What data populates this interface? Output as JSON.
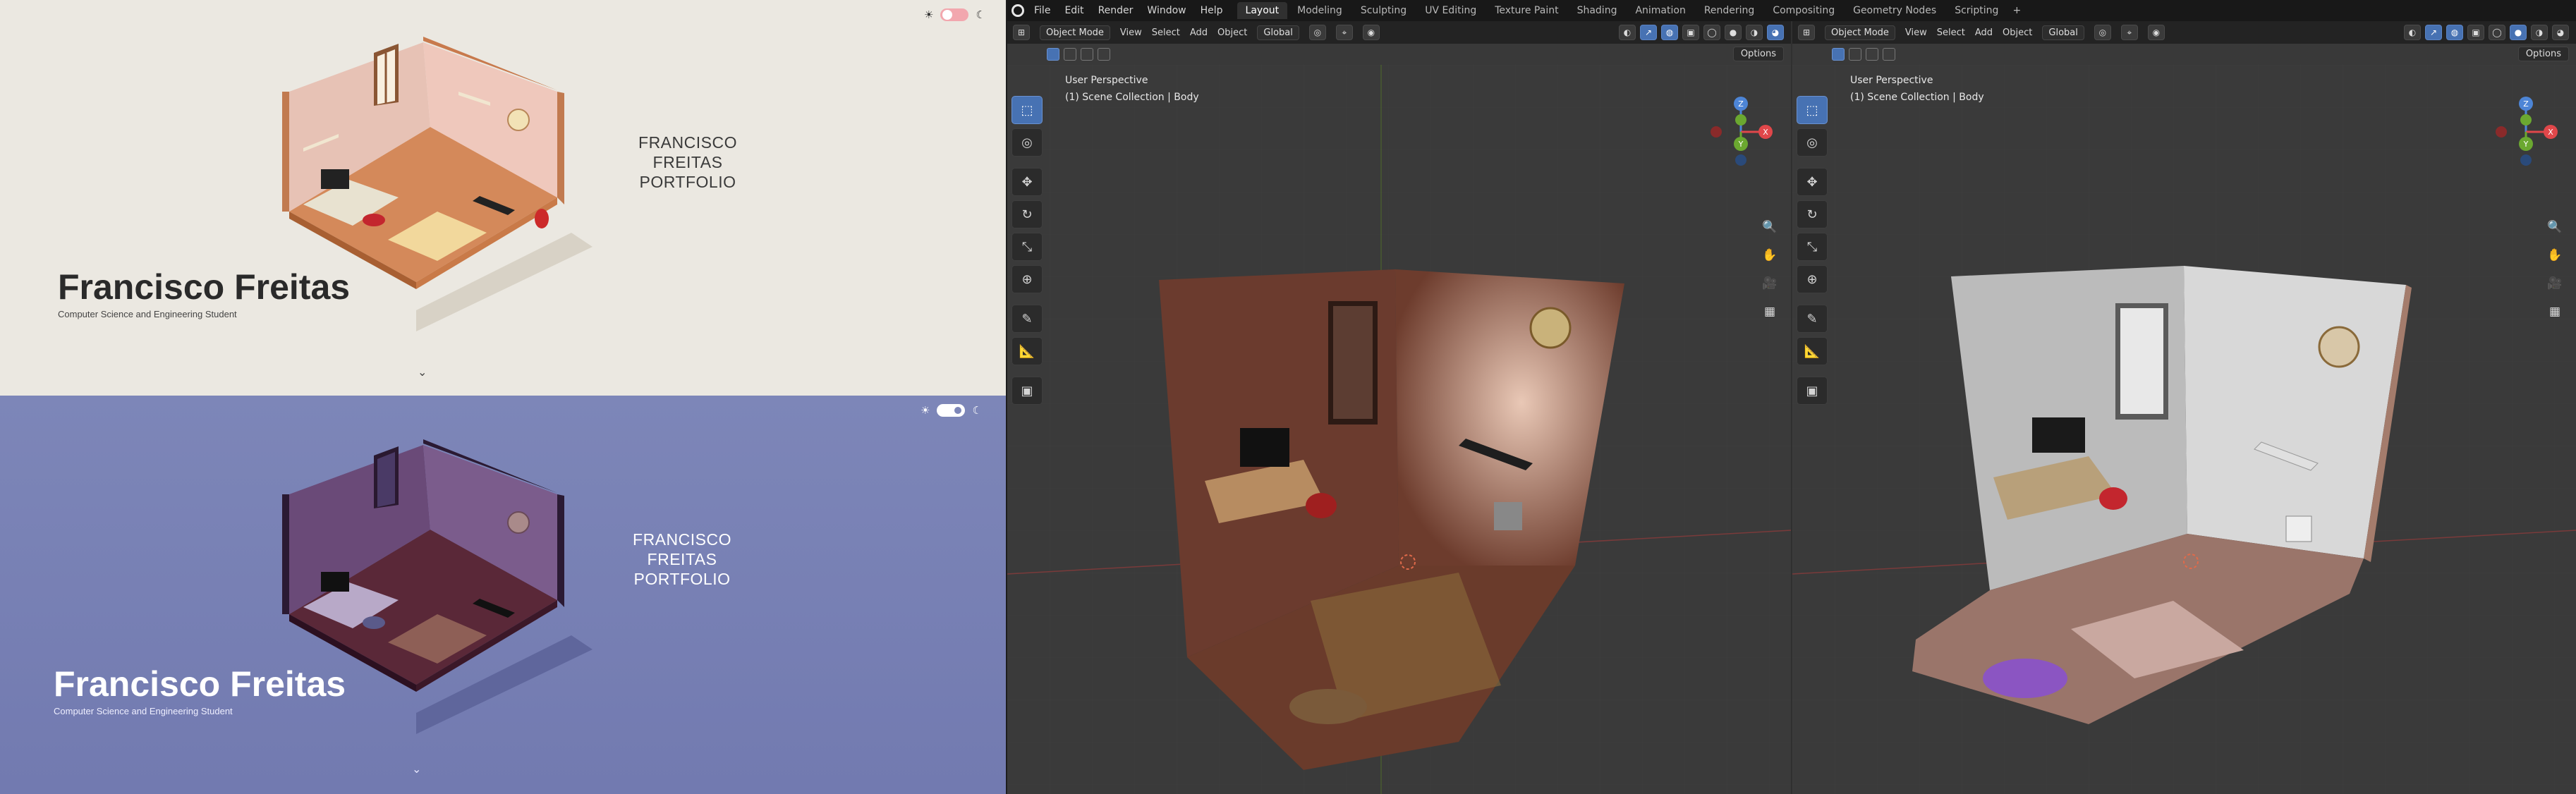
{
  "portfolio_light": {
    "name": "Francisco Freitas",
    "subtitle": "Computer Science and Engineering Student",
    "heading_line1": "FRANCISCO FREITAS",
    "heading_line2": "PORTFOLIO",
    "scroll_icon": "chevron-down-icon",
    "theme": "light"
  },
  "portfolio_dark": {
    "name": "Francisco Freitas",
    "subtitle": "Computer Science and Engineering Student",
    "heading_line1": "FRANCISCO FREITAS",
    "heading_line2": "PORTFOLIO",
    "scroll_icon": "chevron-down-icon",
    "theme": "dark"
  },
  "blender": {
    "menus": [
      "File",
      "Edit",
      "Render",
      "Window",
      "Help"
    ],
    "workspaces": [
      "Layout",
      "Modeling",
      "Sculpting",
      "UV Editing",
      "Texture Paint",
      "Shading",
      "Animation",
      "Rendering",
      "Compositing",
      "Geometry Nodes",
      "Scripting"
    ],
    "active_workspace": "Layout",
    "viewport1": {
      "mode": "Object Mode",
      "menu": [
        "View",
        "Select",
        "Add",
        "Object"
      ],
      "transform": "Global",
      "options": "Options",
      "perspective": "User Perspective",
      "collection": "(1) Scene Collection | Body",
      "shading": "rendered"
    },
    "viewport2": {
      "mode": "Object Mode",
      "menu": [
        "View",
        "Select",
        "Add",
        "Object"
      ],
      "transform": "Global",
      "options": "Options",
      "perspective": "User Perspective",
      "collection": "(1) Scene Collection | Body",
      "shading": "solid"
    }
  },
  "colors": {
    "light_bg": "#ebe8e1",
    "dark_bg": "#7780b5",
    "toggle_pink": "#f2a7ae",
    "blender_blue": "#4772b3"
  }
}
